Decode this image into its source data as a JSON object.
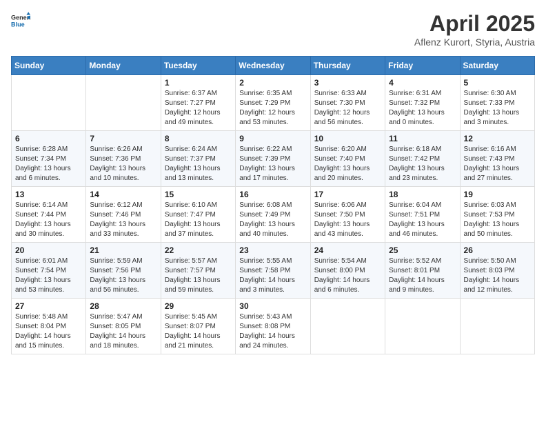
{
  "header": {
    "logo_general": "General",
    "logo_blue": "Blue",
    "month_year": "April 2025",
    "location": "Aflenz Kurort, Styria, Austria"
  },
  "weekdays": [
    "Sunday",
    "Monday",
    "Tuesday",
    "Wednesday",
    "Thursday",
    "Friday",
    "Saturday"
  ],
  "weeks": [
    [
      {
        "day": "",
        "sunrise": "",
        "sunset": "",
        "daylight": ""
      },
      {
        "day": "",
        "sunrise": "",
        "sunset": "",
        "daylight": ""
      },
      {
        "day": "1",
        "sunrise": "Sunrise: 6:37 AM",
        "sunset": "Sunset: 7:27 PM",
        "daylight": "Daylight: 12 hours and 49 minutes."
      },
      {
        "day": "2",
        "sunrise": "Sunrise: 6:35 AM",
        "sunset": "Sunset: 7:29 PM",
        "daylight": "Daylight: 12 hours and 53 minutes."
      },
      {
        "day": "3",
        "sunrise": "Sunrise: 6:33 AM",
        "sunset": "Sunset: 7:30 PM",
        "daylight": "Daylight: 12 hours and 56 minutes."
      },
      {
        "day": "4",
        "sunrise": "Sunrise: 6:31 AM",
        "sunset": "Sunset: 7:32 PM",
        "daylight": "Daylight: 13 hours and 0 minutes."
      },
      {
        "day": "5",
        "sunrise": "Sunrise: 6:30 AM",
        "sunset": "Sunset: 7:33 PM",
        "daylight": "Daylight: 13 hours and 3 minutes."
      }
    ],
    [
      {
        "day": "6",
        "sunrise": "Sunrise: 6:28 AM",
        "sunset": "Sunset: 7:34 PM",
        "daylight": "Daylight: 13 hours and 6 minutes."
      },
      {
        "day": "7",
        "sunrise": "Sunrise: 6:26 AM",
        "sunset": "Sunset: 7:36 PM",
        "daylight": "Daylight: 13 hours and 10 minutes."
      },
      {
        "day": "8",
        "sunrise": "Sunrise: 6:24 AM",
        "sunset": "Sunset: 7:37 PM",
        "daylight": "Daylight: 13 hours and 13 minutes."
      },
      {
        "day": "9",
        "sunrise": "Sunrise: 6:22 AM",
        "sunset": "Sunset: 7:39 PM",
        "daylight": "Daylight: 13 hours and 17 minutes."
      },
      {
        "day": "10",
        "sunrise": "Sunrise: 6:20 AM",
        "sunset": "Sunset: 7:40 PM",
        "daylight": "Daylight: 13 hours and 20 minutes."
      },
      {
        "day": "11",
        "sunrise": "Sunrise: 6:18 AM",
        "sunset": "Sunset: 7:42 PM",
        "daylight": "Daylight: 13 hours and 23 minutes."
      },
      {
        "day": "12",
        "sunrise": "Sunrise: 6:16 AM",
        "sunset": "Sunset: 7:43 PM",
        "daylight": "Daylight: 13 hours and 27 minutes."
      }
    ],
    [
      {
        "day": "13",
        "sunrise": "Sunrise: 6:14 AM",
        "sunset": "Sunset: 7:44 PM",
        "daylight": "Daylight: 13 hours and 30 minutes."
      },
      {
        "day": "14",
        "sunrise": "Sunrise: 6:12 AM",
        "sunset": "Sunset: 7:46 PM",
        "daylight": "Daylight: 13 hours and 33 minutes."
      },
      {
        "day": "15",
        "sunrise": "Sunrise: 6:10 AM",
        "sunset": "Sunset: 7:47 PM",
        "daylight": "Daylight: 13 hours and 37 minutes."
      },
      {
        "day": "16",
        "sunrise": "Sunrise: 6:08 AM",
        "sunset": "Sunset: 7:49 PM",
        "daylight": "Daylight: 13 hours and 40 minutes."
      },
      {
        "day": "17",
        "sunrise": "Sunrise: 6:06 AM",
        "sunset": "Sunset: 7:50 PM",
        "daylight": "Daylight: 13 hours and 43 minutes."
      },
      {
        "day": "18",
        "sunrise": "Sunrise: 6:04 AM",
        "sunset": "Sunset: 7:51 PM",
        "daylight": "Daylight: 13 hours and 46 minutes."
      },
      {
        "day": "19",
        "sunrise": "Sunrise: 6:03 AM",
        "sunset": "Sunset: 7:53 PM",
        "daylight": "Daylight: 13 hours and 50 minutes."
      }
    ],
    [
      {
        "day": "20",
        "sunrise": "Sunrise: 6:01 AM",
        "sunset": "Sunset: 7:54 PM",
        "daylight": "Daylight: 13 hours and 53 minutes."
      },
      {
        "day": "21",
        "sunrise": "Sunrise: 5:59 AM",
        "sunset": "Sunset: 7:56 PM",
        "daylight": "Daylight: 13 hours and 56 minutes."
      },
      {
        "day": "22",
        "sunrise": "Sunrise: 5:57 AM",
        "sunset": "Sunset: 7:57 PM",
        "daylight": "Daylight: 13 hours and 59 minutes."
      },
      {
        "day": "23",
        "sunrise": "Sunrise: 5:55 AM",
        "sunset": "Sunset: 7:58 PM",
        "daylight": "Daylight: 14 hours and 3 minutes."
      },
      {
        "day": "24",
        "sunrise": "Sunrise: 5:54 AM",
        "sunset": "Sunset: 8:00 PM",
        "daylight": "Daylight: 14 hours and 6 minutes."
      },
      {
        "day": "25",
        "sunrise": "Sunrise: 5:52 AM",
        "sunset": "Sunset: 8:01 PM",
        "daylight": "Daylight: 14 hours and 9 minutes."
      },
      {
        "day": "26",
        "sunrise": "Sunrise: 5:50 AM",
        "sunset": "Sunset: 8:03 PM",
        "daylight": "Daylight: 14 hours and 12 minutes."
      }
    ],
    [
      {
        "day": "27",
        "sunrise": "Sunrise: 5:48 AM",
        "sunset": "Sunset: 8:04 PM",
        "daylight": "Daylight: 14 hours and 15 minutes."
      },
      {
        "day": "28",
        "sunrise": "Sunrise: 5:47 AM",
        "sunset": "Sunset: 8:05 PM",
        "daylight": "Daylight: 14 hours and 18 minutes."
      },
      {
        "day": "29",
        "sunrise": "Sunrise: 5:45 AM",
        "sunset": "Sunset: 8:07 PM",
        "daylight": "Daylight: 14 hours and 21 minutes."
      },
      {
        "day": "30",
        "sunrise": "Sunrise: 5:43 AM",
        "sunset": "Sunset: 8:08 PM",
        "daylight": "Daylight: 14 hours and 24 minutes."
      },
      {
        "day": "",
        "sunrise": "",
        "sunset": "",
        "daylight": ""
      },
      {
        "day": "",
        "sunrise": "",
        "sunset": "",
        "daylight": ""
      },
      {
        "day": "",
        "sunrise": "",
        "sunset": "",
        "daylight": ""
      }
    ]
  ]
}
